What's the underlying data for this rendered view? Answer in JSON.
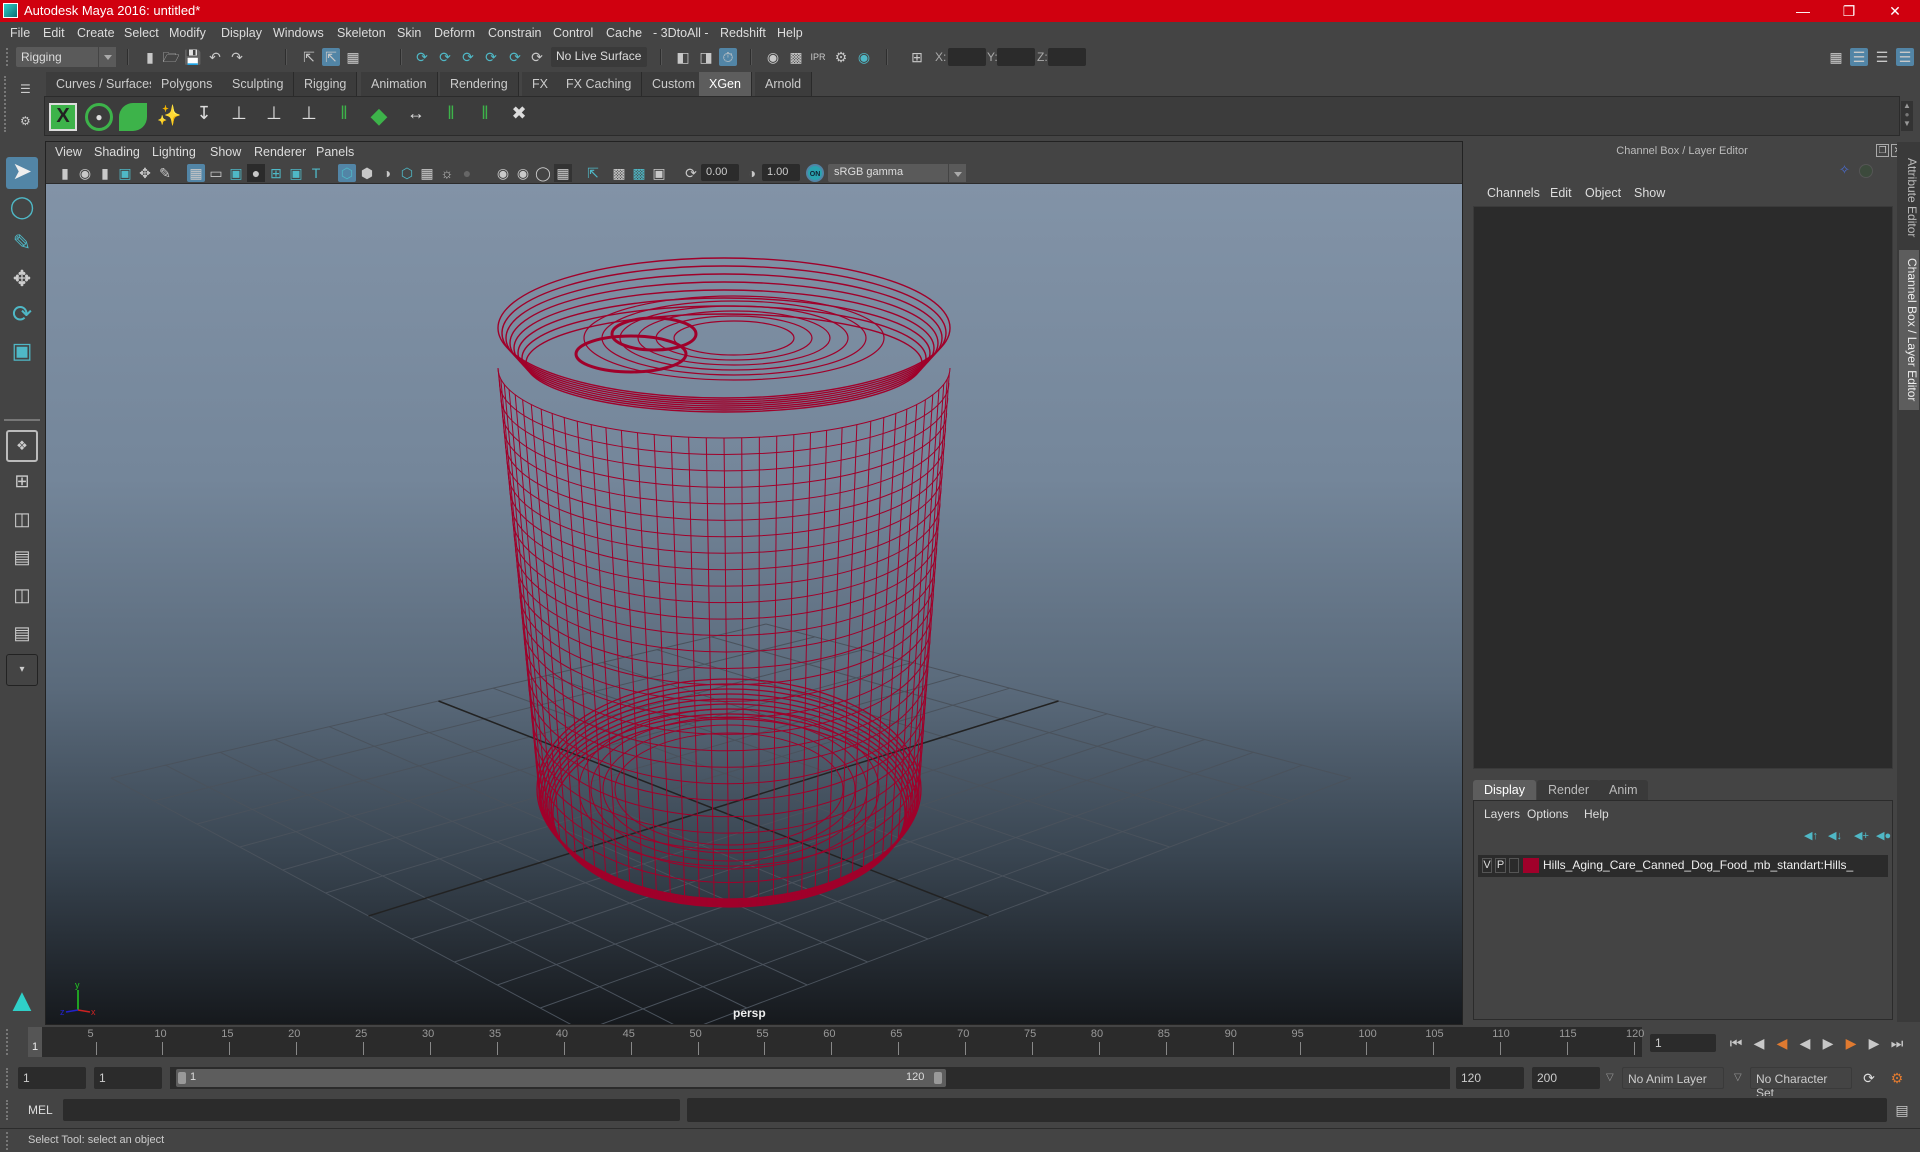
{
  "window": {
    "title": "Autodesk Maya 2016: untitled*",
    "controls": [
      "minimize",
      "restore",
      "close"
    ]
  },
  "menubar": [
    "File",
    "Edit",
    "Create",
    "Select",
    "Modify",
    "Display",
    "Windows",
    "Skeleton",
    "Skin",
    "Deform",
    "Constrain",
    "Control",
    "Cache",
    "- 3DtoAll -",
    "Redshift",
    "Help"
  ],
  "status_line": {
    "menu_set": "Rigging",
    "live_surface": "No Live Surface",
    "x_label": "X:",
    "y_label": "Y:",
    "z_label": "Z:",
    "x_value": "",
    "y_value": "",
    "z_value": ""
  },
  "shelf_tabs": [
    {
      "label": "Curves / Surfaces",
      "active": false
    },
    {
      "label": "Polygons",
      "active": false
    },
    {
      "label": "Sculpting",
      "active": false
    },
    {
      "label": "Rigging",
      "active": false
    },
    {
      "label": "Animation",
      "active": false
    },
    {
      "label": "Rendering",
      "active": false
    },
    {
      "label": "FX",
      "active": false
    },
    {
      "label": "FX Caching",
      "active": false
    },
    {
      "label": "Custom",
      "active": false
    },
    {
      "label": "XGen",
      "active": true
    },
    {
      "label": "Arnold",
      "active": false
    }
  ],
  "shelf_icons": [
    "xgen-editor",
    "create-description",
    "toggle-visibility",
    "add-guides",
    "place-guides",
    "add-guide",
    "sculpt-guide",
    "lock-guide",
    "split-guide",
    "guide-spline",
    "move-guide",
    "select-guides",
    "rebuild-guides",
    "delete-guides"
  ],
  "tool_box": [
    "select-tool",
    "lasso-tool",
    "paint-select-tool",
    "move-tool",
    "rotate-tool",
    "scale-tool"
  ],
  "viewport": {
    "menu": [
      "View",
      "Shading",
      "Lighting",
      "Show",
      "Renderer",
      "Panels"
    ],
    "exposure": "0.00",
    "gamma": "1.00",
    "color_mgmt_badge": "ON",
    "color_space": "sRGB gamma",
    "camera_label": "persp",
    "axis": {
      "x": "x",
      "y": "y",
      "z": "z"
    },
    "wireframe_color": "#a0002a"
  },
  "channel_box": {
    "title": "Channel Box / Layer Editor",
    "menu": [
      "Channels",
      "Edit",
      "Object",
      "Show"
    ]
  },
  "side_tabs": [
    "Attribute Editor",
    "Channel Box / Layer Editor"
  ],
  "layer_editor": {
    "tabs": [
      {
        "label": "Display",
        "active": true
      },
      {
        "label": "Render",
        "active": false
      },
      {
        "label": "Anim",
        "active": false
      }
    ],
    "menu": [
      "Layers",
      "Options",
      "Help"
    ],
    "layers": [
      {
        "v": "V",
        "p": "P",
        "color": "#a0002a",
        "name": "Hills_Aging_Care_Canned_Dog_Food_mb_standart:Hills_"
      }
    ]
  },
  "timeline": {
    "ticks": [
      "5",
      "10",
      "15",
      "20",
      "25",
      "30",
      "35",
      "40",
      "45",
      "50",
      "55",
      "60",
      "65",
      "70",
      "75",
      "80",
      "85",
      "90",
      "95",
      "100",
      "105",
      "110",
      "115",
      "120"
    ],
    "current_frame_marker": "1",
    "current_frame": "1"
  },
  "range_slider": {
    "start_time": "1",
    "playback_start": "1",
    "range_start_label": "1",
    "range_end_label": "120",
    "playback_end": "120",
    "end_time": "200",
    "anim_layer": "No Anim Layer",
    "character_set": "No Character Set"
  },
  "command_line": {
    "label": "MEL",
    "value": ""
  },
  "help_line": "Select Tool: select an object"
}
